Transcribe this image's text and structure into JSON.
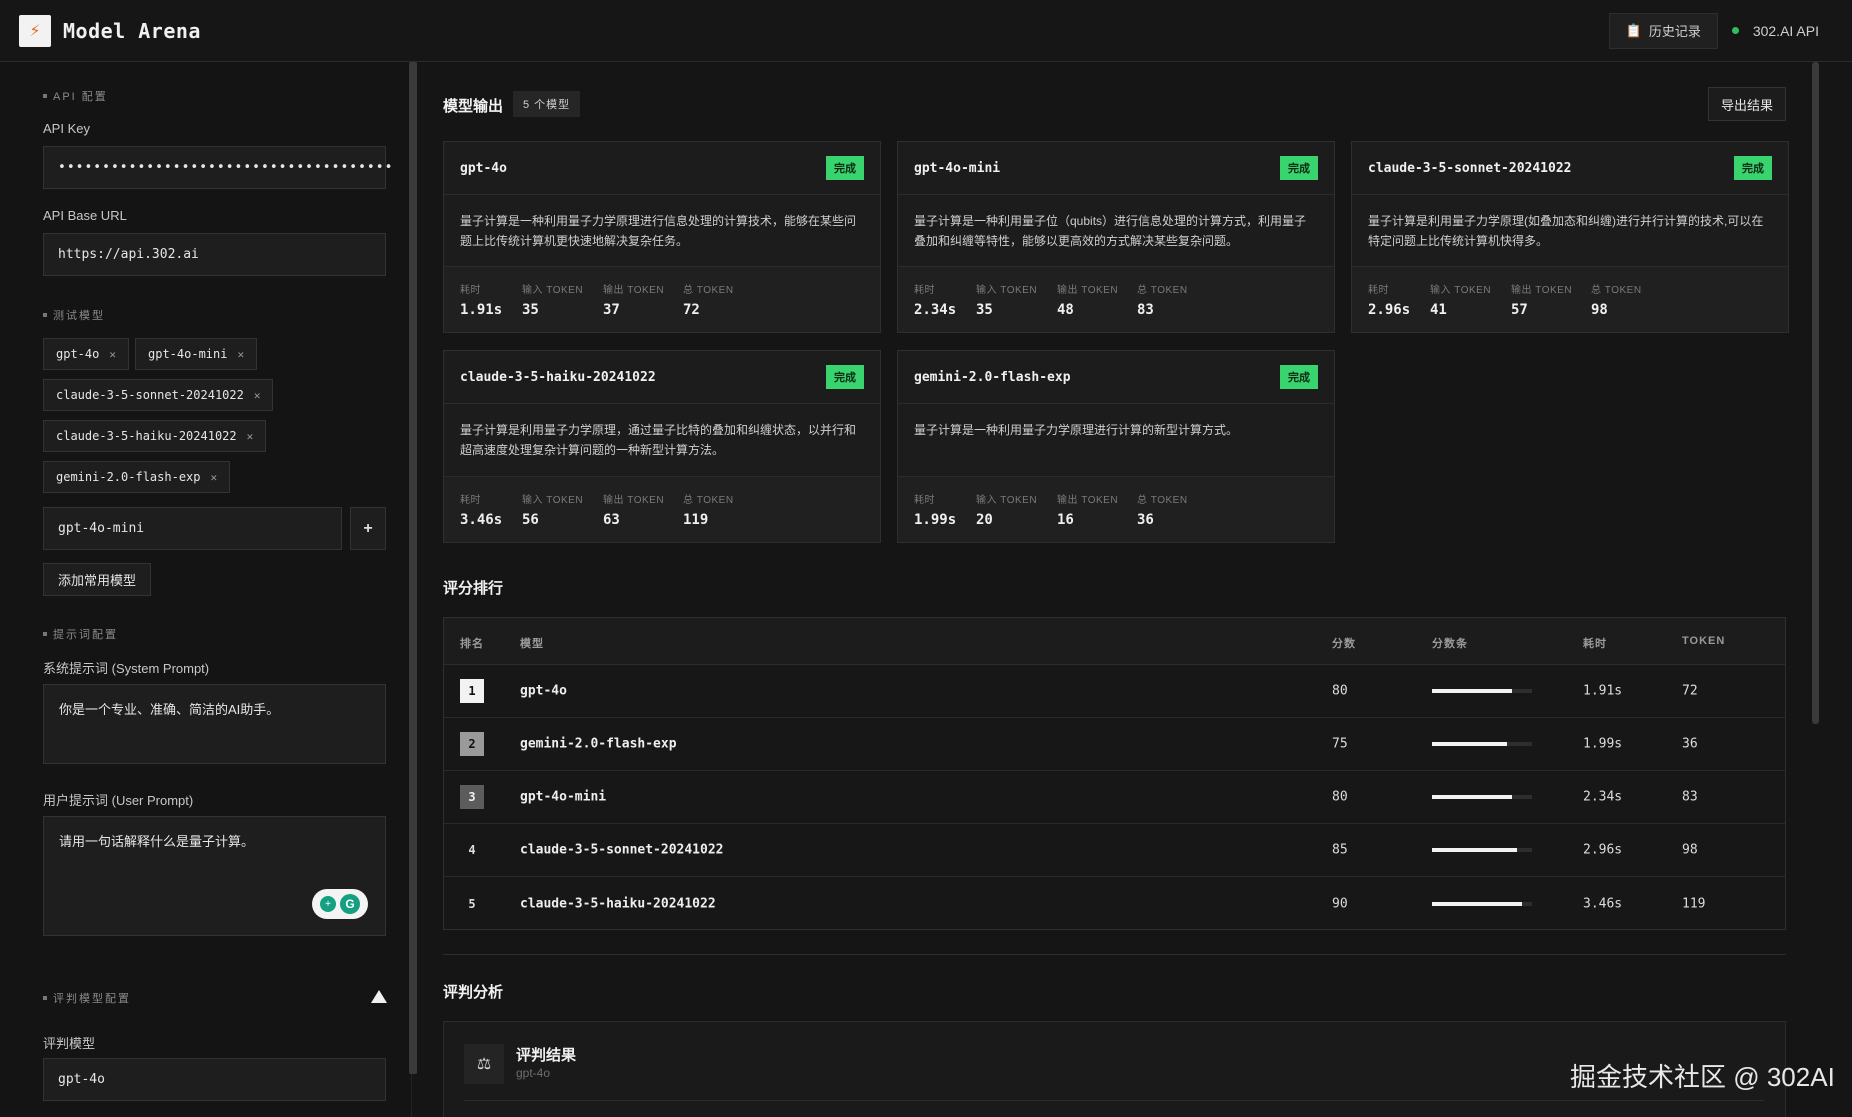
{
  "header": {
    "app_title": "Model Arena",
    "history_label": "历史记录",
    "api_label": "302.AI API"
  },
  "sidebar": {
    "api_section": "API 配置",
    "api_key_label": "API Key",
    "api_key_value": "••••••••••••••••••••••••••••••••••••••",
    "base_url_label": "API Base URL",
    "base_url_value": "https://api.302.ai",
    "models_section": "测试模型",
    "models": [
      "gpt-4o",
      "gpt-4o-mini",
      "claude-3-5-sonnet-20241022",
      "claude-3-5-haiku-20241022",
      "gemini-2.0-flash-exp"
    ],
    "model_input_value": "gpt-4o-mini",
    "add_button": "+",
    "add_common_button": "添加常用模型",
    "prompt_section": "提示词配置",
    "system_prompt_label": "系统提示词 (System Prompt)",
    "system_prompt_value": "你是一个专业、准确、简洁的AI助手。",
    "user_prompt_label": "用户提示词 (User Prompt)",
    "user_prompt_value": "请用一句话解释什么是量子计算。",
    "judge_section": "评判模型配置",
    "judge_model_label": "评判模型",
    "judge_model_value": "gpt-4o"
  },
  "main": {
    "output_title": "模型输出",
    "model_count": "5 个模型",
    "export_button": "导出结果",
    "stat_labels": {
      "time": "耗时",
      "input": "输入 TOKEN",
      "output": "输出 TOKEN",
      "total": "总 TOKEN"
    },
    "done_label": "完成",
    "cards": [
      {
        "name": "gpt-4o",
        "text": "量子计算是一种利用量子力学原理进行信息处理的计算技术，能够在某些问题上比传统计算机更快速地解决复杂任务。",
        "time": "1.91s",
        "input": "35",
        "output": "37",
        "total": "72"
      },
      {
        "name": "gpt-4o-mini",
        "text": "量子计算是一种利用量子位（qubits）进行信息处理的计算方式，利用量子叠加和纠缠等特性，能够以更高效的方式解决某些复杂问题。",
        "time": "2.34s",
        "input": "35",
        "output": "48",
        "total": "83"
      },
      {
        "name": "claude-3-5-sonnet-20241022",
        "text": "量子计算是利用量子力学原理(如叠加态和纠缠)进行并行计算的技术,可以在特定问题上比传统计算机快得多。",
        "time": "2.96s",
        "input": "41",
        "output": "57",
        "total": "98"
      },
      {
        "name": "claude-3-5-haiku-20241022",
        "text": "量子计算是利用量子力学原理，通过量子比特的叠加和纠缠状态，以并行和超高速度处理复杂计算问题的一种新型计算方法。",
        "time": "3.46s",
        "input": "56",
        "output": "63",
        "total": "119"
      },
      {
        "name": "gemini-2.0-flash-exp",
        "text": "量子计算是一种利用量子力学原理进行计算的新型计算方式。",
        "time": "1.99s",
        "input": "20",
        "output": "16",
        "total": "36"
      }
    ],
    "ranking_title": "评分排行",
    "ranking_headers": {
      "rank": "排名",
      "model": "模型",
      "score": "分数",
      "bar": "分数条",
      "time": "耗时",
      "token": "TOKEN"
    },
    "ranking": [
      {
        "rank": "1",
        "model": "gpt-4o",
        "score": "80",
        "bar_pct": 80,
        "time": "1.91s",
        "token": "72"
      },
      {
        "rank": "2",
        "model": "gemini-2.0-flash-exp",
        "score": "75",
        "bar_pct": 75,
        "time": "1.99s",
        "token": "36"
      },
      {
        "rank": "3",
        "model": "gpt-4o-mini",
        "score": "80",
        "bar_pct": 80,
        "time": "2.34s",
        "token": "83"
      },
      {
        "rank": "4",
        "model": "claude-3-5-sonnet-20241022",
        "score": "85",
        "bar_pct": 85,
        "time": "2.96s",
        "token": "98"
      },
      {
        "rank": "5",
        "model": "claude-3-5-haiku-20241022",
        "score": "90",
        "bar_pct": 90,
        "time": "3.46s",
        "token": "119"
      }
    ],
    "analysis_title": "评判分析",
    "analysis_result_title": "评判结果",
    "analysis_result_model": "gpt-4o"
  },
  "watermark": "掘金技术社区 @ 302AI"
}
